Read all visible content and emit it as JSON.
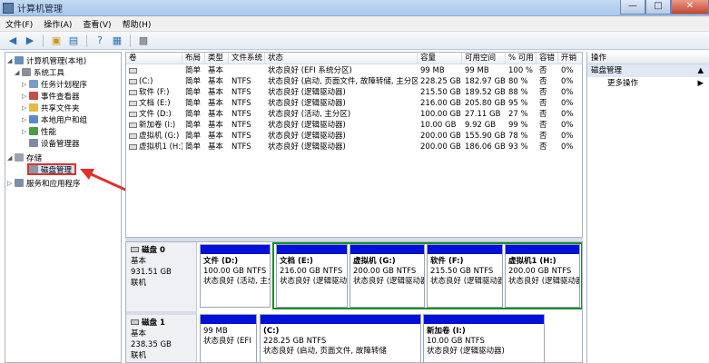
{
  "window": {
    "title": "计算机管理",
    "min": "—",
    "max": "□",
    "close": "✕"
  },
  "menu": [
    "文件(F)",
    "操作(A)",
    "查看(V)",
    "帮助(H)"
  ],
  "tree": {
    "root": "计算机管理(本地)",
    "system_tools": "系统工具",
    "task_scheduler": "任务计划程序",
    "event_viewer": "事件查看器",
    "shared_folders": "共享文件夹",
    "local_users": "本地用户和组",
    "performance": "性能",
    "device_manager": "设备管理器",
    "storage": "存储",
    "disk_management": "磁盘管理",
    "services_apps": "服务和应用程序"
  },
  "volume_list": {
    "headers": [
      "卷",
      "布局",
      "类型",
      "文件系统",
      "状态",
      "容量",
      "可用空间",
      "% 可用",
      "容错",
      "开销"
    ],
    "rows": [
      [
        "",
        "简单",
        "基本",
        "",
        "状态良好 (EFI 系统分区)",
        "99 MB",
        "99 MB",
        "100 %",
        "否",
        "0%"
      ],
      [
        "(C:)",
        "简单",
        "基本",
        "NTFS",
        "状态良好 (启动, 页面文件, 故障转储, 主分区)",
        "228.25 GB",
        "182.97 GB",
        "80 %",
        "否",
        "0%"
      ],
      [
        "软件 (F:)",
        "简单",
        "基本",
        "NTFS",
        "状态良好 (逻辑驱动器)",
        "215.50 GB",
        "189.52 GB",
        "88 %",
        "否",
        "0%"
      ],
      [
        "文档 (E:)",
        "简单",
        "基本",
        "NTFS",
        "状态良好 (逻辑驱动器)",
        "216.00 GB",
        "205.80 GB",
        "95 %",
        "否",
        "0%"
      ],
      [
        "文件 (D:)",
        "简单",
        "基本",
        "NTFS",
        "状态良好 (活动, 主分区)",
        "100.00 GB",
        "27.11 GB",
        "27 %",
        "否",
        "0%"
      ],
      [
        "新加卷 (I:)",
        "简单",
        "基本",
        "NTFS",
        "状态良好 (逻辑驱动器)",
        "10.00 GB",
        "9.92 GB",
        "99 %",
        "否",
        "0%"
      ],
      [
        "虚拟机 (G:)",
        "简单",
        "基本",
        "NTFS",
        "状态良好 (逻辑驱动器)",
        "200.00 GB",
        "155.90 GB",
        "78 %",
        "否",
        "0%"
      ],
      [
        "虚拟机1 (H:)",
        "简单",
        "基本",
        "NTFS",
        "状态良好 (逻辑驱动器)",
        "200.00 GB",
        "186.06 GB",
        "93 %",
        "否",
        "0%"
      ]
    ]
  },
  "disks": [
    {
      "name": "磁盘 0",
      "type": "基本",
      "size": "931.51 GB",
      "status": "联机",
      "partitions": [
        {
          "name": "文件 (D:)",
          "size": "100.00 GB NTFS",
          "status": "状态良好 (活动, 主分"
        },
        {
          "name": "文档 (E:)",
          "size": "216.00 GB NTFS",
          "status": "状态良好 (逻辑驱动器)"
        },
        {
          "name": "虚拟机 (G:)",
          "size": "200.00 GB NTFS",
          "status": "状态良好 (逻辑驱动器)"
        },
        {
          "name": "软件 (F:)",
          "size": "215.50 GB NTFS",
          "status": "状态良好 (逻辑驱动器)"
        },
        {
          "name": "虚拟机1 (H:)",
          "size": "200.00 GB NTFS",
          "status": "状态良好 (逻辑驱动器)"
        }
      ]
    },
    {
      "name": "磁盘 1",
      "type": "基本",
      "size": "238.35 GB",
      "status": "联机",
      "partitions": [
        {
          "name": "",
          "size": "99 MB",
          "status": "状态良好 (EFI"
        },
        {
          "name": "(C:)",
          "size": "228.25 GB NTFS",
          "status": "状态良好 (启动, 页面文件, 故障转储"
        },
        {
          "name": "新加卷 (I:)",
          "size": "10.00 GB NTFS",
          "status": "状态良好 (逻辑驱动器)"
        }
      ]
    }
  ],
  "actions": {
    "title": "操作",
    "section": "磁盘管理",
    "more": "更多操作",
    "arrow_up": "▲",
    "arrow_right": "▶"
  },
  "colors": {
    "primary_bar": "#0010d8",
    "extended_border": "#1d8a2a",
    "arrow": "#e0302a"
  }
}
